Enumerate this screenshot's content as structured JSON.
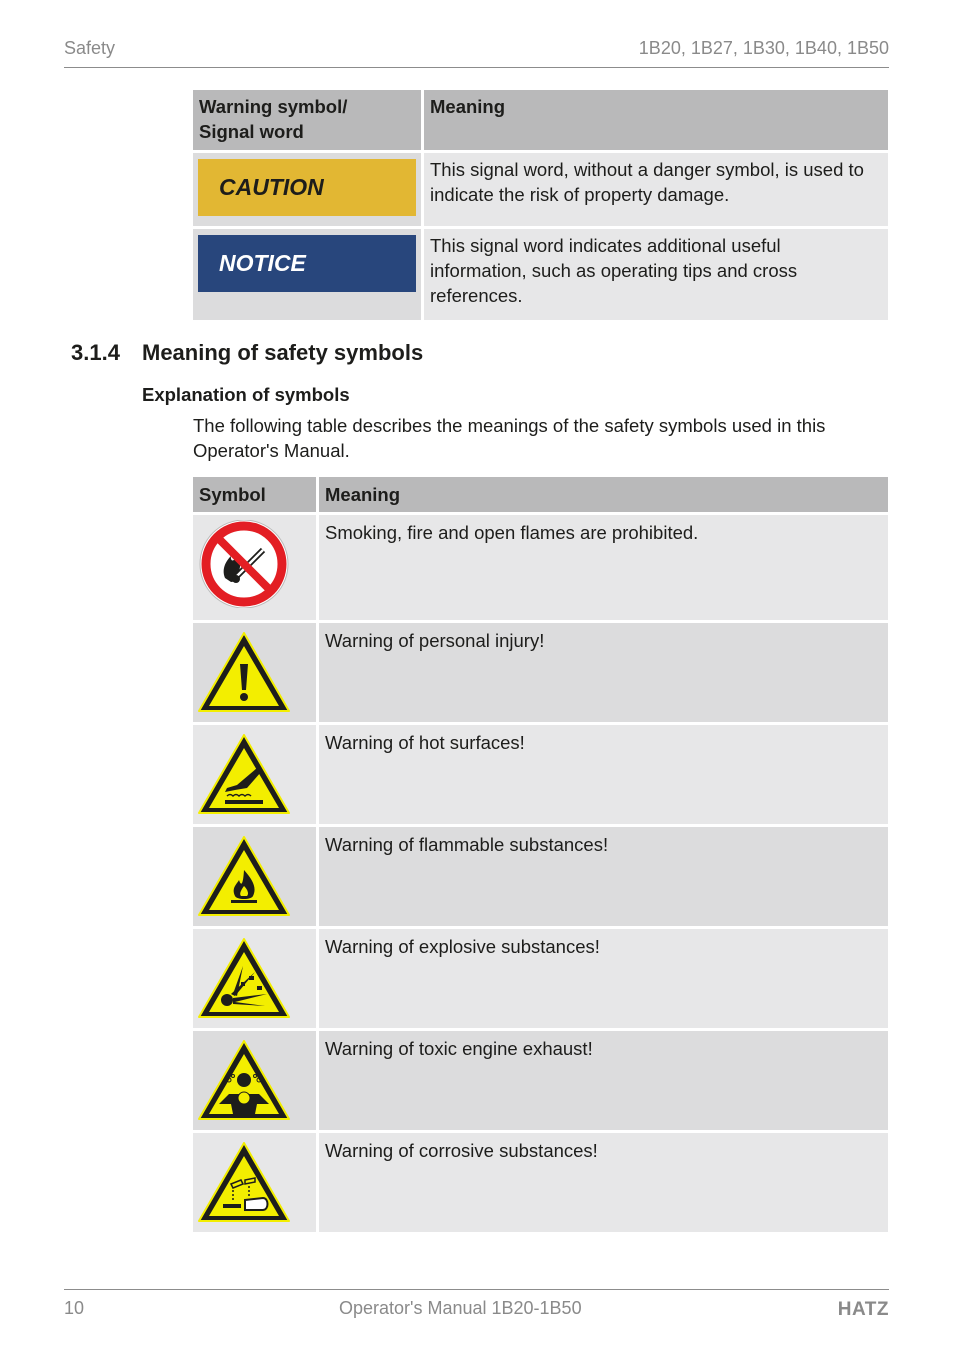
{
  "header": {
    "section": "Safety",
    "models": "1B20, 1B27, 1B30, 1B40, 1B50"
  },
  "signal_table": {
    "headers": [
      "Warning symbol/\nSignal word",
      "Meaning"
    ],
    "header_col1_line1": "Warning symbol/",
    "header_col1_line2": "Signal word",
    "header_col2": "Meaning",
    "rows": [
      {
        "signal_word": "CAUTION",
        "color": "#e2b733",
        "text_color": "#1d1d1b",
        "meaning": "This signal word, without a danger symbol, is used to indicate the risk of property damage."
      },
      {
        "signal_word": "NOTICE",
        "color": "#28467c",
        "text_color": "#ffffff",
        "meaning": "This signal word indicates additional useful information, such as operating tips and cross references."
      }
    ]
  },
  "section": {
    "number": "3.1.4",
    "title": "Meaning of safety symbols",
    "subheading": "Explanation of symbols",
    "intro": "The following table describes the meanings of the safety symbols used in this Operator's Manual."
  },
  "symbol_table": {
    "header_symbol": "Symbol",
    "header_meaning": "Meaning",
    "rows": [
      {
        "icon": "no-open-flame-icon",
        "meaning": "Smoking, fire and open flames are prohibited."
      },
      {
        "icon": "general-warning-icon",
        "meaning": "Warning of personal injury!"
      },
      {
        "icon": "hot-surface-warning-icon",
        "meaning": "Warning of hot surfaces!"
      },
      {
        "icon": "flammable-warning-icon",
        "meaning": "Warning of flammable substances!"
      },
      {
        "icon": "explosive-warning-icon",
        "meaning": "Warning of explosive substances!"
      },
      {
        "icon": "toxic-exhaust-warning-icon",
        "meaning": "Warning of toxic engine exhaust!"
      },
      {
        "icon": "corrosive-warning-icon",
        "meaning": "Warning of corrosive substances!"
      }
    ]
  },
  "colors": {
    "warning_yellow": "#f3ee00",
    "prohibition_red": "#e31e24"
  },
  "footer": {
    "page_number": "10",
    "manual_title": "Operator's Manual 1B20-1B50",
    "brand": "HATZ"
  }
}
